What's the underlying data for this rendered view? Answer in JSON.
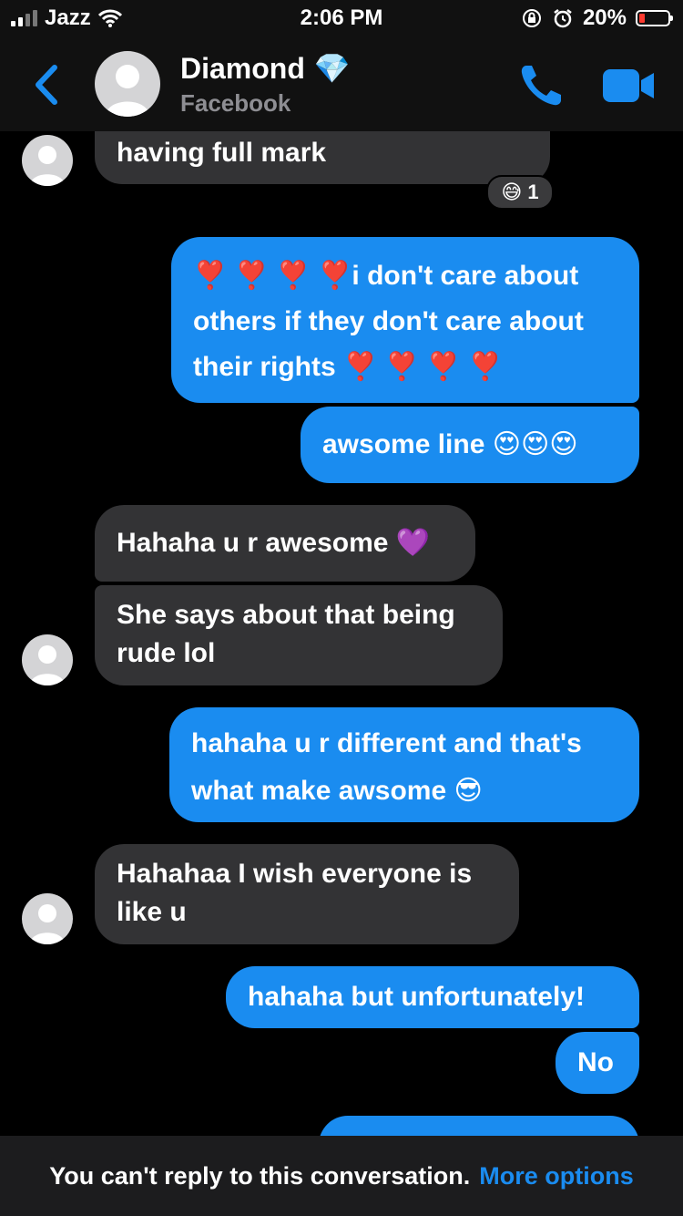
{
  "status_bar": {
    "carrier": "Jazz",
    "time": "2:06 PM",
    "battery_percent": "20%",
    "battery_level": 0.2,
    "battery_color": "#ff3b30"
  },
  "header": {
    "contact_name": "Diamond",
    "contact_emoji": "💎",
    "subtitle": "Facebook",
    "icons": [
      "back-chevron-icon",
      "phone-icon",
      "video-camera-icon"
    ],
    "accent": "#1a8cf0"
  },
  "messages": [
    {
      "side": "in",
      "text": "having full mark",
      "reaction": {
        "emoji": "😅",
        "count": "1"
      }
    },
    {
      "side": "out",
      "lines": [
        "❣️ ❣️ ❣️ ❣️i don't care about",
        "others if they don't care about",
        "their rights ❣️ ❣️ ❣️ ❣️"
      ]
    },
    {
      "side": "out",
      "text": "awsome line 😍😍😍"
    },
    {
      "side": "in",
      "text": "Hahaha u r awesome 💜"
    },
    {
      "side": "in",
      "lines": [
        "She says about that being",
        "rude lol"
      ]
    },
    {
      "side": "out",
      "lines": [
        "hahaha u r different and that's",
        "what make awsome 😎"
      ]
    },
    {
      "side": "in",
      "lines": [
        "Hahahaa I wish everyone is",
        "like u"
      ]
    },
    {
      "side": "out",
      "text": "hahaha but unfortunately!"
    },
    {
      "side": "out",
      "text": "No"
    }
  ],
  "footer": {
    "notice": "You can't reply to this conversation.",
    "link": "More options"
  }
}
